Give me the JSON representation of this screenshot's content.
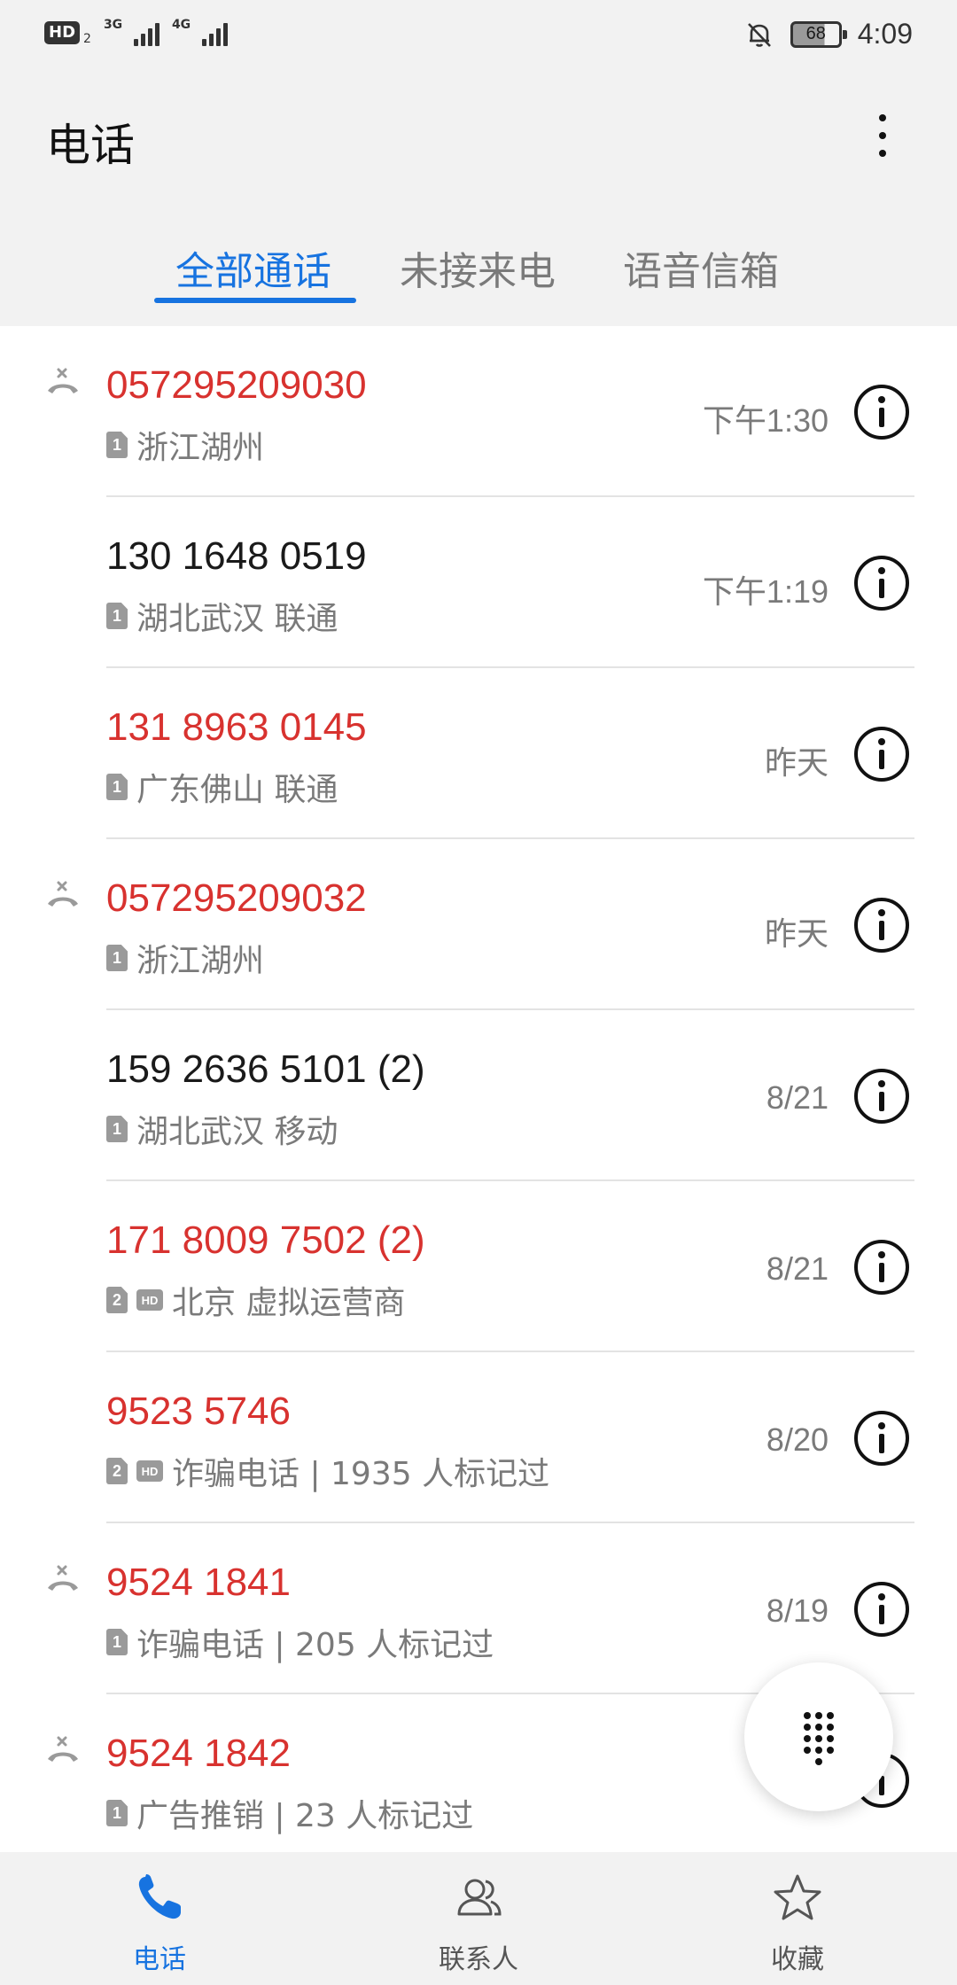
{
  "status_bar": {
    "hd_label": "HD",
    "hd_sub": "2",
    "signal1_label": "3G",
    "signal2_label": "4G",
    "battery_level": "68",
    "time": "4:09"
  },
  "header": {
    "title": "电话"
  },
  "tabs": [
    {
      "label": "全部通话",
      "active": true
    },
    {
      "label": "未接来电",
      "active": false
    },
    {
      "label": "语音信箱",
      "active": false
    }
  ],
  "calls": [
    {
      "number": "057295209030",
      "missed": true,
      "color": "red",
      "sim": "1",
      "hd": false,
      "location": "浙江湖州",
      "time": "下午1:30",
      "missed_icon": true
    },
    {
      "number": "130 1648 0519",
      "missed": false,
      "color": "black",
      "sim": "1",
      "hd": false,
      "location": "湖北武汉 联通",
      "time": "下午1:19",
      "missed_icon": false
    },
    {
      "number": "131 8963 0145",
      "missed": true,
      "color": "red",
      "sim": "1",
      "hd": false,
      "location": "广东佛山 联通",
      "time": "昨天",
      "missed_icon": false
    },
    {
      "number": "057295209032",
      "missed": true,
      "color": "red",
      "sim": "1",
      "hd": false,
      "location": "浙江湖州",
      "time": "昨天",
      "missed_icon": true
    },
    {
      "number": "159 2636 5101 (2)",
      "missed": false,
      "color": "black",
      "sim": "1",
      "hd": false,
      "location": "湖北武汉 移动",
      "time": "8/21",
      "missed_icon": false
    },
    {
      "number": "171 8009 7502  (2)",
      "missed": true,
      "color": "red",
      "sim": "2",
      "hd": true,
      "location": "北京 虚拟运营商",
      "time": "8/21",
      "missed_icon": false
    },
    {
      "number": "9523 5746",
      "missed": true,
      "color": "red",
      "sim": "2",
      "hd": true,
      "location": "诈骗电话 | 1935 人标记过",
      "time": "8/20",
      "missed_icon": false
    },
    {
      "number": "9524 1841",
      "missed": true,
      "color": "red",
      "sim": "1",
      "hd": false,
      "location": "诈骗电话 | 205 人标记过",
      "time": "8/19",
      "missed_icon": true
    },
    {
      "number": "9524 1842",
      "missed": true,
      "color": "red",
      "sim": "1",
      "hd": false,
      "location": "广告推销 | 23 人标记过",
      "time": "",
      "missed_icon": true
    }
  ],
  "hd_badge_text": "HD",
  "bottom_nav": [
    {
      "label": "电话",
      "icon": "phone-icon",
      "active": true
    },
    {
      "label": "联系人",
      "icon": "contacts-icon",
      "active": false
    },
    {
      "label": "收藏",
      "icon": "star-icon",
      "active": false
    }
  ],
  "colors": {
    "accent": "#1773e0",
    "missed": "#d8322f",
    "secondary_text": "#7a7a7a",
    "background": "#f2f2f2"
  }
}
